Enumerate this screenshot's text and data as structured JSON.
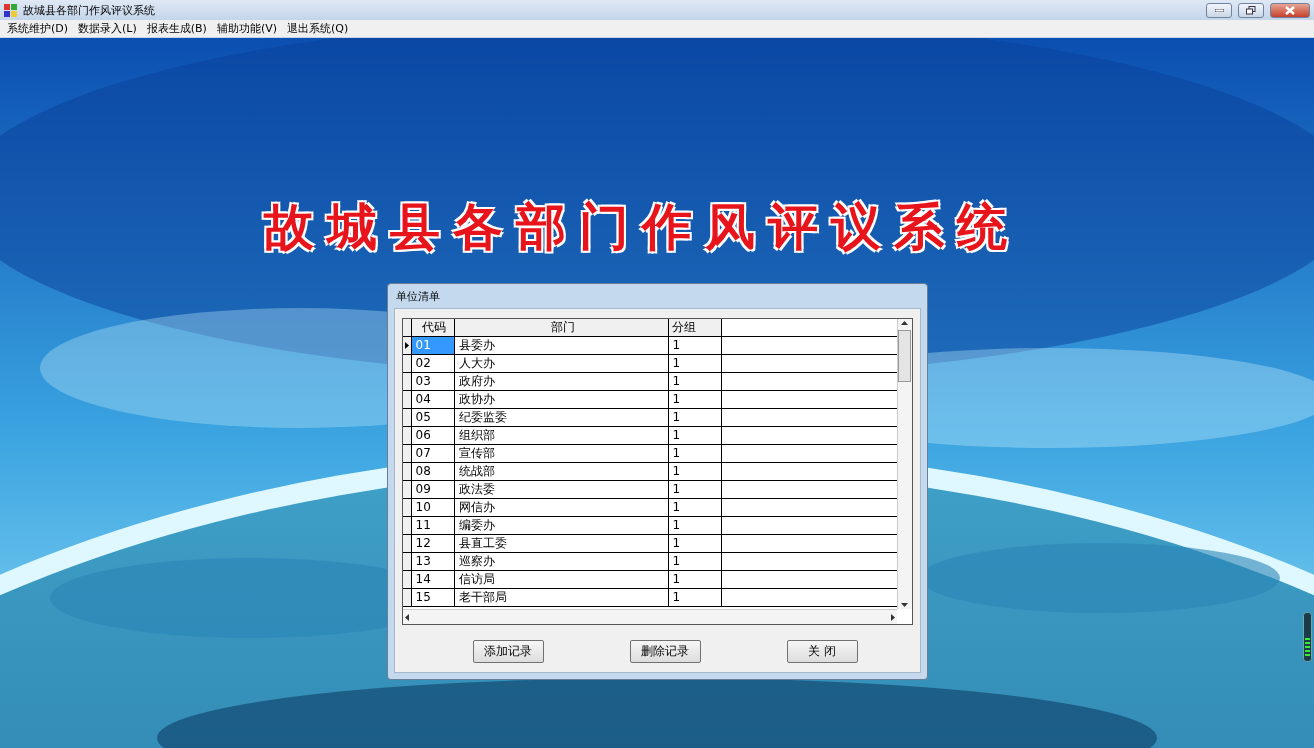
{
  "window": {
    "title": "故城县各部门作风评议系统"
  },
  "menu": [
    {
      "label": "系统维护(D)"
    },
    {
      "label": "数据录入(L)"
    },
    {
      "label": "报表生成(B)"
    },
    {
      "label": "辅助功能(V)"
    },
    {
      "label": "退出系统(Q)"
    }
  ],
  "banner": "故城县各部门作风评议系统",
  "dialog": {
    "title": "单位清单",
    "table": {
      "columns": [
        "代码",
        "部门",
        "分组"
      ],
      "rows": [
        {
          "cells": [
            "01",
            "县委办",
            "1"
          ],
          "selected": true
        },
        {
          "cells": [
            "02",
            "人大办",
            "1"
          ],
          "selected": false
        },
        {
          "cells": [
            "03",
            "政府办",
            "1"
          ],
          "selected": false
        },
        {
          "cells": [
            "04",
            "政协办",
            "1"
          ],
          "selected": false
        },
        {
          "cells": [
            "05",
            "纪委监委",
            "1"
          ],
          "selected": false
        },
        {
          "cells": [
            "06",
            "组织部",
            "1"
          ],
          "selected": false
        },
        {
          "cells": [
            "07",
            "宣传部",
            "1"
          ],
          "selected": false
        },
        {
          "cells": [
            "08",
            "统战部",
            "1"
          ],
          "selected": false
        },
        {
          "cells": [
            "09",
            "政法委",
            "1"
          ],
          "selected": false
        },
        {
          "cells": [
            "10",
            "网信办",
            "1"
          ],
          "selected": false
        },
        {
          "cells": [
            "11",
            "编委办",
            "1"
          ],
          "selected": false
        },
        {
          "cells": [
            "12",
            "县直工委",
            "1"
          ],
          "selected": false
        },
        {
          "cells": [
            "13",
            "巡察办",
            "1"
          ],
          "selected": false
        },
        {
          "cells": [
            "14",
            "信访局",
            "1"
          ],
          "selected": false
        },
        {
          "cells": [
            "15",
            "老干部局",
            "1"
          ],
          "selected": false
        }
      ]
    },
    "buttons": [
      {
        "label": "添加记录"
      },
      {
        "label": "删除记录"
      },
      {
        "label": "关 闭"
      }
    ]
  }
}
